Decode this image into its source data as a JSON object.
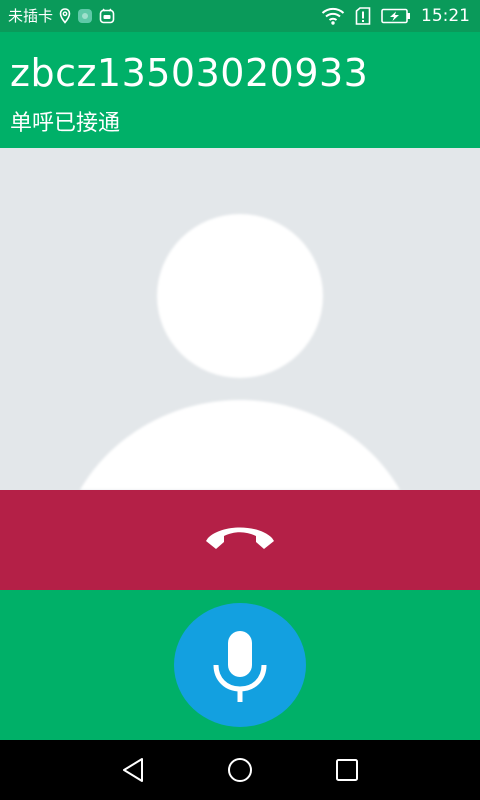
{
  "status_bar": {
    "carrier": "未插卡",
    "time": "15:21",
    "icons": [
      "location-icon",
      "app-icon",
      "notification-icon",
      "wifi-icon",
      "sim-icon",
      "battery-charging-icon"
    ]
  },
  "call": {
    "contact_name": "zbcz13503020933",
    "status": "单呼已接通"
  },
  "colors": {
    "status_bar": "#0a9a5a",
    "header": "#00b068",
    "avatar_bg": "#e3e7ea",
    "hangup": "#b42047",
    "mic": "#13a0e0",
    "nav": "#000000"
  },
  "buttons": {
    "hangup_icon": "phone-hangup-icon",
    "mic_icon": "microphone-icon"
  },
  "nav_bar": {
    "items": [
      "back-icon",
      "home-icon",
      "recent-apps-icon"
    ]
  }
}
